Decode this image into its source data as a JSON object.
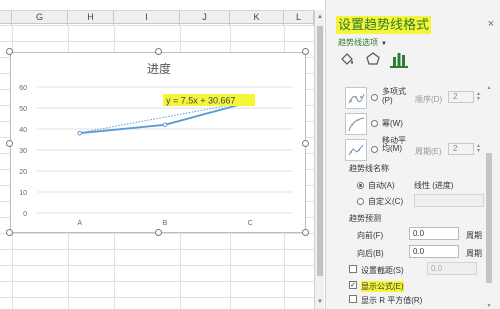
{
  "sheet": {
    "columns": [
      "G",
      "H",
      "I",
      "J",
      "K",
      "L"
    ]
  },
  "chart": {
    "title": "进度",
    "yticks": [
      "60",
      "50",
      "40",
      "30",
      "20",
      "10",
      "0"
    ],
    "categories": [
      "A",
      "B",
      "C"
    ],
    "trend_equation": "y = 7.5x + 30.667"
  },
  "chart_data": {
    "type": "line",
    "title": "进度",
    "categories": [
      "A",
      "B",
      "C"
    ],
    "series": [
      {
        "values": [
          38,
          42,
          53
        ]
      }
    ],
    "trendline": {
      "type": "linear",
      "equation": "y = 7.5x + 30.667",
      "values": [
        38.17,
        45.67,
        53.17
      ]
    },
    "ylim": [
      0,
      60
    ],
    "yticks": [
      0,
      10,
      20,
      30,
      40,
      50,
      60
    ],
    "grid": true,
    "line_color": "#5b9bd5",
    "trend_color": "#5b9bd5"
  },
  "pane": {
    "title": "设置趋势线格式",
    "close": "×",
    "subtitle": "趋势线选项",
    "options": [
      {
        "label": "多项式(P)",
        "spin_label": "顺序(D)",
        "spin_value": "2"
      },
      {
        "label": "幂(W)"
      },
      {
        "label": "移动平均(M)",
        "spin_label": "周期(E)",
        "spin_value": "2"
      }
    ],
    "name_section": "趋势线名称",
    "auto_label": "自动(A)",
    "auto_value": "线性 (进度)",
    "custom_label": "自定义(C)",
    "forecast_section": "趋势预测",
    "forward_label": "向前(F)",
    "forward_value": "0.0",
    "forward_unit": "周期",
    "backward_label": "向后(B)",
    "backward_value": "0.0",
    "backward_unit": "周期",
    "intercept_label": "设置截距(S)",
    "intercept_value": "0.0",
    "show_equation_label": "显示公式(E)",
    "show_r2_label": "显示 R 平方值(R)"
  },
  "colors": {
    "accent_green": "#2e7d32",
    "highlight_yellow": "#f5f53a",
    "series_blue": "#5b9bd5"
  }
}
